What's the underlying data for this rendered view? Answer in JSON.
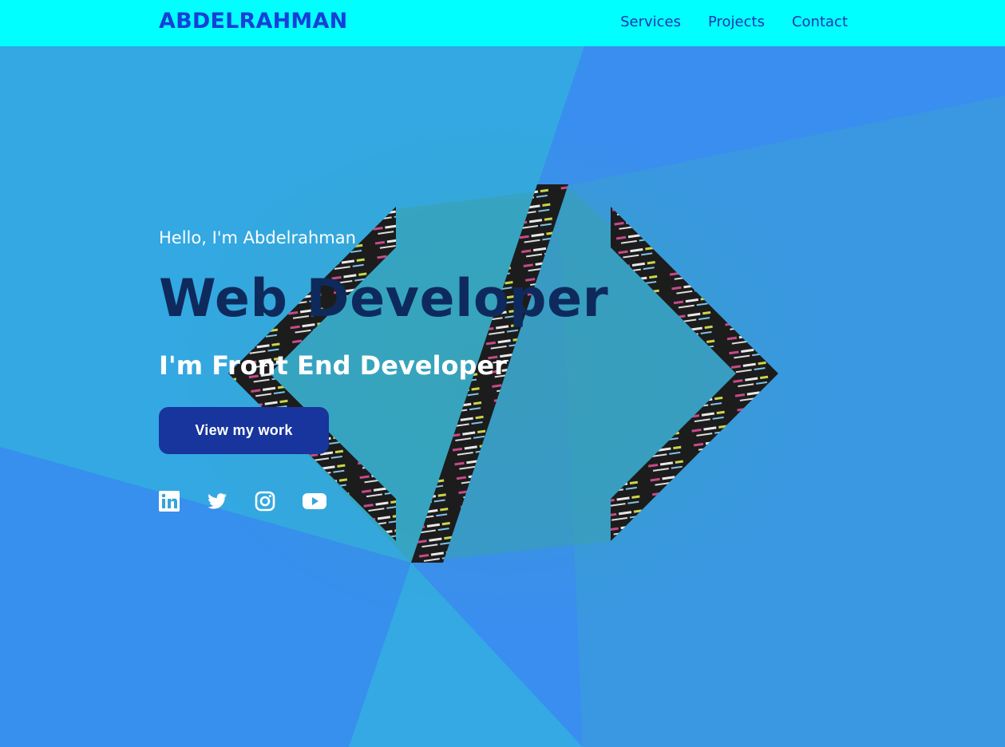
{
  "navbar": {
    "brand": "ABDELRAHMAN",
    "links": [
      "Services",
      "Projects",
      "Contact"
    ]
  },
  "hero": {
    "greeting": "Hello, I'm Abdelrahman",
    "headline": "Web Developer",
    "subheadline": "I'm Front End Developer",
    "cta_label": "View my work",
    "social_icons": [
      "linkedin-icon",
      "twitter-icon",
      "instagram-icon",
      "youtube-icon"
    ],
    "background_art": "code-brackets-icon"
  },
  "colors": {
    "navbar_bg": "#00ffff",
    "brand": "#1640d8",
    "nav_link": "#1a35b0",
    "hero_bg": "#36a3dc",
    "headline": "#0e2a5c",
    "cta_bg": "#17359c",
    "text_light": "#ffffff"
  }
}
